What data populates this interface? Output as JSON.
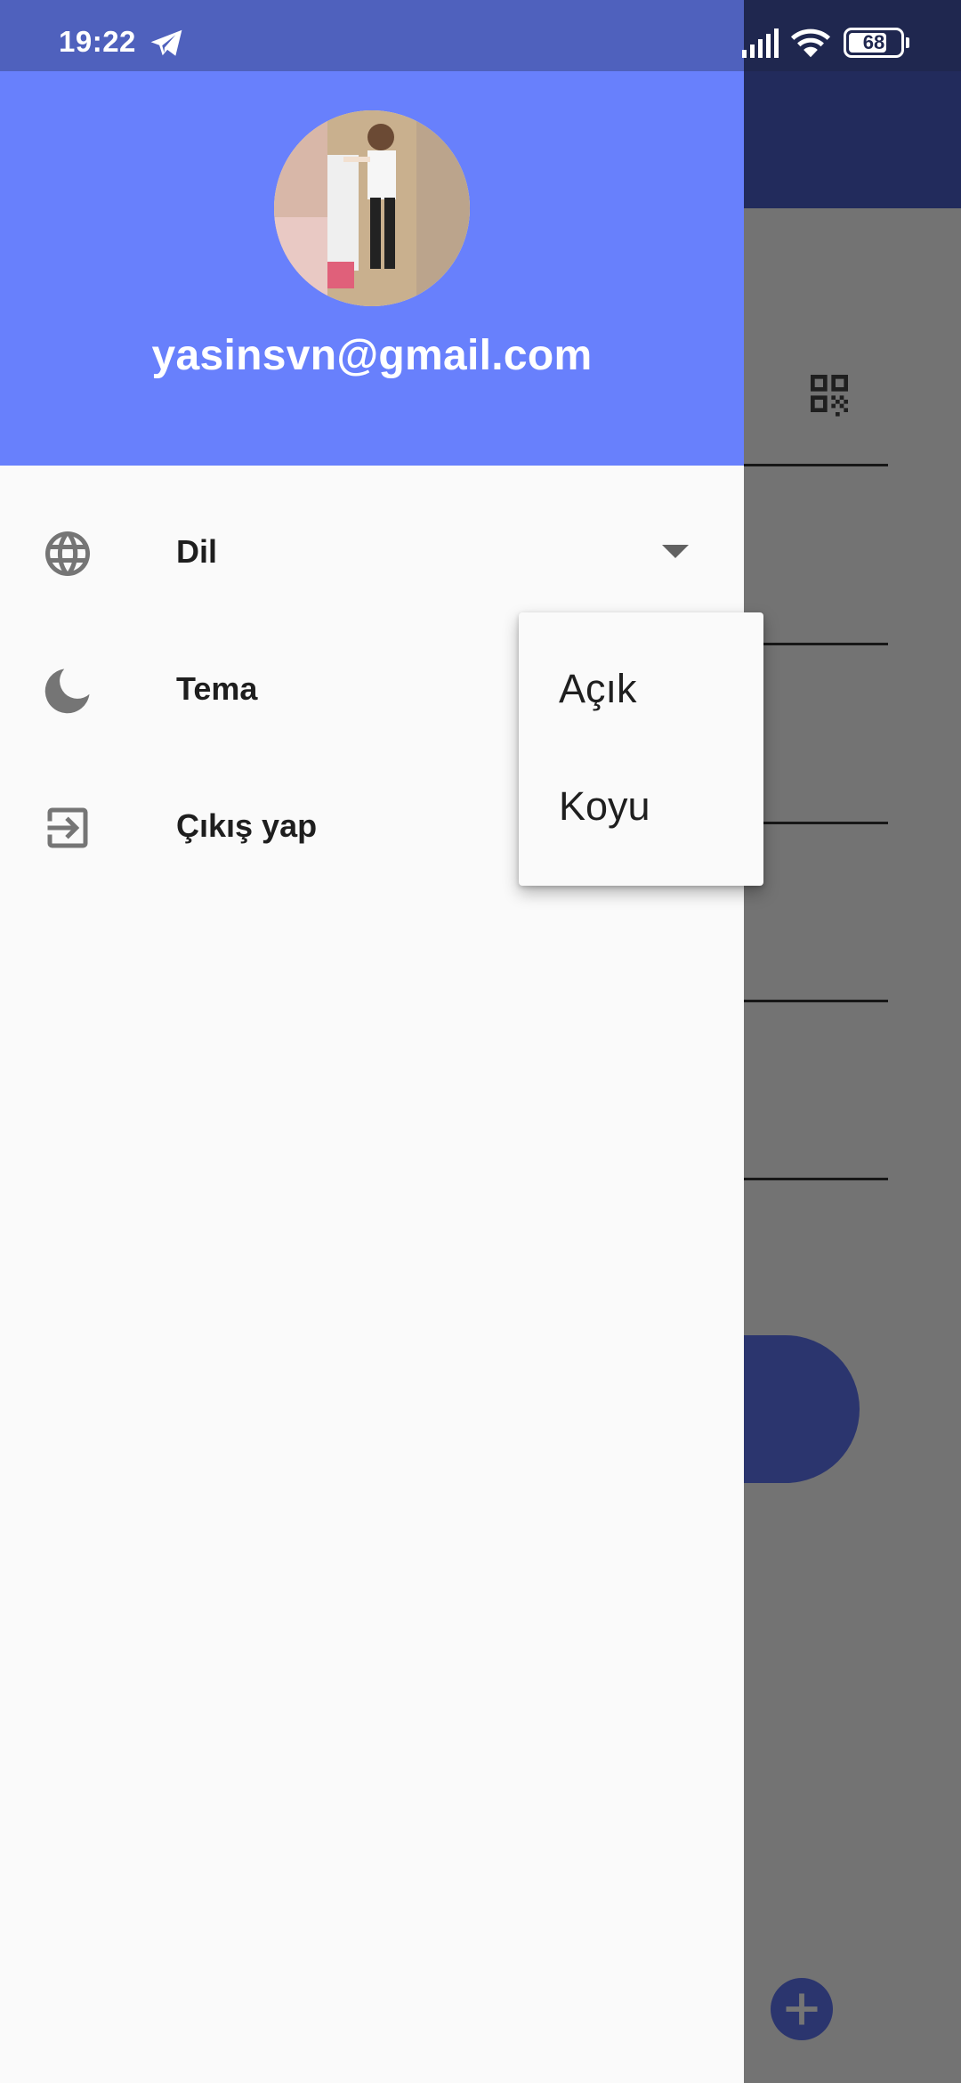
{
  "status_bar": {
    "time": "19:22",
    "battery_level": "68",
    "icons": [
      "telegram-icon",
      "signal-icon",
      "wifi-icon",
      "battery-icon"
    ]
  },
  "drawer": {
    "header": {
      "email": "yasinsvn@gmail.com",
      "background_color": "#6880fc"
    },
    "items": [
      {
        "label": "Dil",
        "icon": "globe-icon",
        "has_dropdown": true
      },
      {
        "label": "Tema",
        "icon": "moon-icon"
      },
      {
        "label": "Çıkış yap",
        "icon": "logout-icon"
      }
    ]
  },
  "theme_menu": {
    "options": [
      "Açık",
      "Koyu"
    ]
  },
  "background_app": {
    "app_bar_color": "#4a5fc8",
    "icons": [
      "qr-code-icon",
      "add-icon"
    ]
  }
}
